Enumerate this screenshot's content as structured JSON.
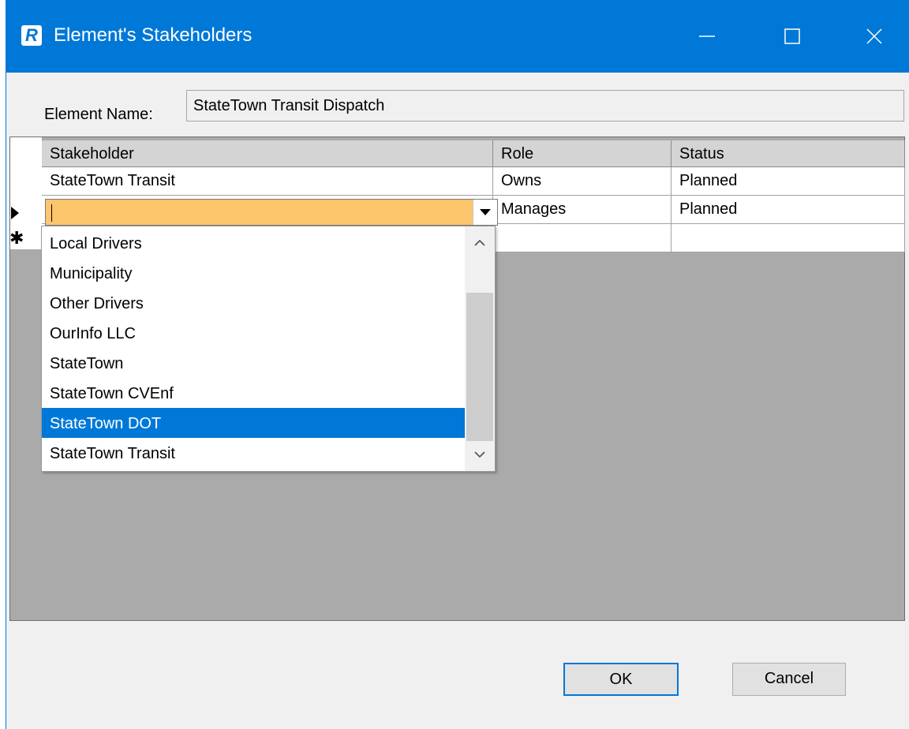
{
  "window": {
    "title": "Element's Stakeholders",
    "icon_letter": "R",
    "accent_color": "#0078d7",
    "controls": [
      "minimize-icon",
      "maximize-icon",
      "close-icon"
    ]
  },
  "form": {
    "element_name_label": "Element Name:",
    "element_name_value": "StateTown Transit Dispatch"
  },
  "grid": {
    "columns": [
      "Stakeholder",
      "Role",
      "Status"
    ],
    "rows": [
      {
        "stakeholder": "StateTown Transit",
        "role": "Owns",
        "status": "Planned"
      },
      {
        "stakeholder": "",
        "role": "Manages",
        "status": "Planned",
        "editing": true
      },
      {
        "stakeholder": "",
        "role": "",
        "status": "",
        "new_row": true
      }
    ],
    "current_row_marker": "▶",
    "new_row_marker": "✱",
    "edit_cell_color": "#fdc56c"
  },
  "dropdown": {
    "options": [
      "Local Drivers",
      "Municipality",
      "Other Drivers",
      "OurInfo LLC",
      "StateTown",
      "StateTown CVEnf",
      "StateTown DOT",
      "StateTown Transit"
    ],
    "selected": "StateTown DOT",
    "selected_index": 6
  },
  "buttons": {
    "ok": "OK",
    "cancel": "Cancel"
  }
}
